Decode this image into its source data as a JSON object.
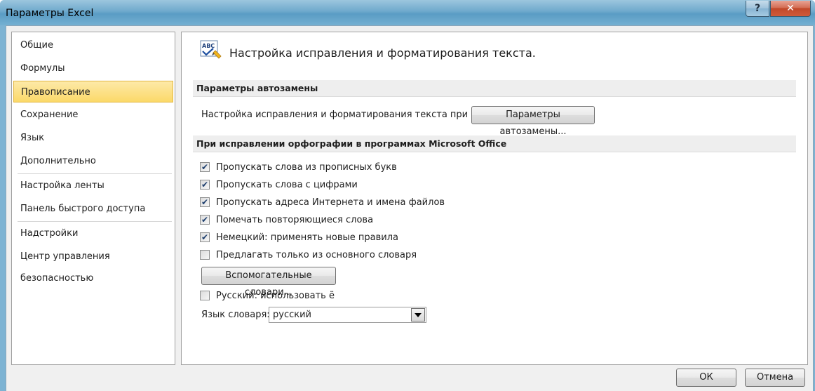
{
  "window": {
    "title": "Параметры Excel",
    "help_label": "?",
    "close_label": "✕"
  },
  "sidebar": {
    "items": [
      {
        "label": "Общие"
      },
      {
        "label": "Формулы"
      },
      {
        "label": "Правописание",
        "selected": true
      },
      {
        "label": "Сохранение"
      },
      {
        "label": "Язык"
      },
      {
        "label": "Дополнительно"
      },
      {
        "label": "Настройка ленты"
      },
      {
        "label": "Панель быстрого доступа"
      },
      {
        "label": "Надстройки"
      },
      {
        "label": "Центр управления безопасностью"
      }
    ]
  },
  "main": {
    "icon": "abc-spellcheck-icon",
    "icon_text": "ABC",
    "title": "Настройка исправления и форматирования текста.",
    "autocorrect": {
      "header": "Параметры автозамены",
      "description": "Настройка исправления и форматирования текста при вводе:",
      "button": "Параметры автозамены..."
    },
    "spelling": {
      "header": "При исправлении орфографии в программах Microsoft Office",
      "options": [
        {
          "label": "Пропускать слова из прописных букв",
          "checked": true
        },
        {
          "label": "Пропускать слова с цифрами",
          "checked": true
        },
        {
          "label": "Пропускать адреса Интернета и имена файлов",
          "checked": true
        },
        {
          "label": "Помечать повторяющиеся слова",
          "checked": true
        },
        {
          "label": "Немецкий: применять новые правила",
          "checked": true
        },
        {
          "label": "Предлагать только из основного словаря",
          "checked": false
        }
      ],
      "dictionaries_button": "Вспомогательные словари...",
      "russian_yo": {
        "label": "Русский: использовать ё",
        "checked": false
      },
      "dictionary_language_label": "Язык словаря:",
      "dictionary_language_value": "русский"
    }
  },
  "footer": {
    "ok": "ОК",
    "cancel": "Отмена"
  },
  "colors": {
    "selected_nav": "#fbd969",
    "section_header": "#eeeeee",
    "titlebar": "#6ea9cc",
    "close_button": "#c1482a"
  }
}
